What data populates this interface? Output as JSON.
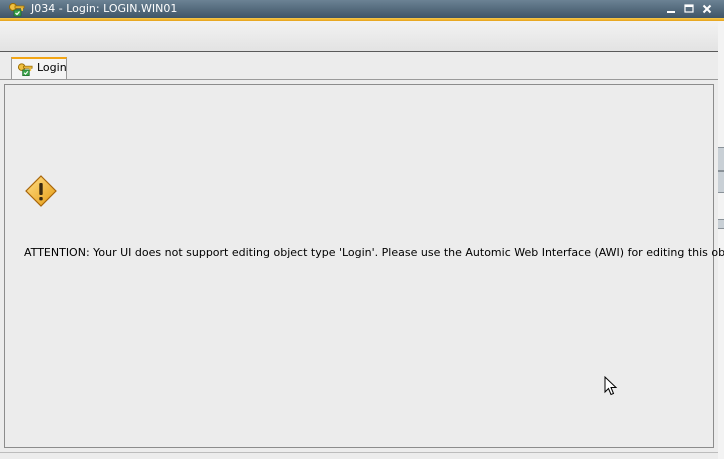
{
  "window": {
    "title": "J034 - Login: LOGIN.WIN01",
    "icon": "login-key-icon",
    "controls": {
      "minimize": "minimize-icon",
      "maximize": "maximize-icon",
      "close": "close-icon"
    }
  },
  "tabs": [
    {
      "label": "Login",
      "icon": "login-key-icon",
      "active": true
    }
  ],
  "main": {
    "icon": "warning-icon",
    "message": "ATTENTION: Your UI does not support editing object type 'Login'. Please use the Automic Web Interface (AWI) for editing this object."
  },
  "colors": {
    "titlebar": "#4f6678",
    "accent": "#f2a515",
    "background": "#ececec"
  }
}
